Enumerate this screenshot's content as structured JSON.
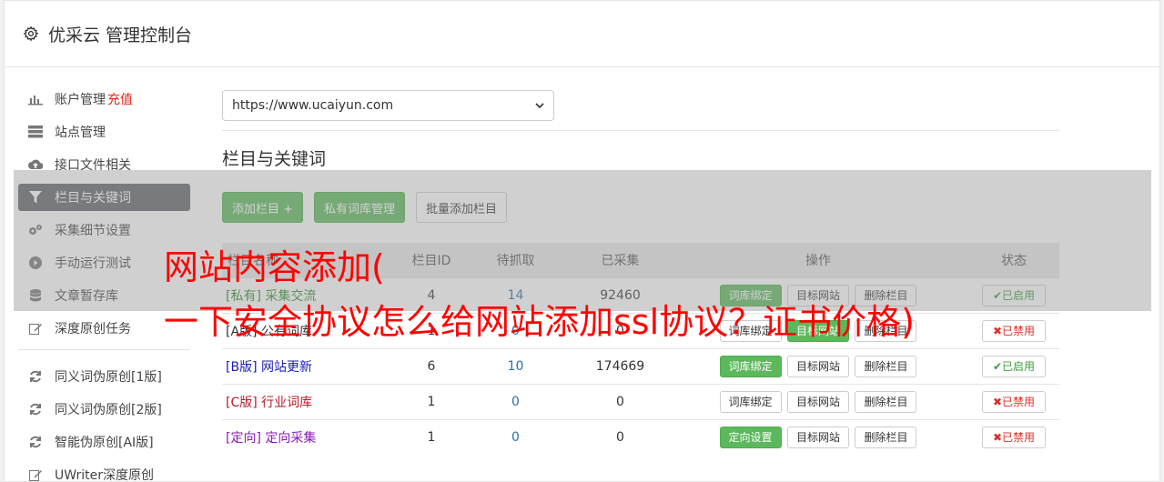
{
  "header": {
    "title": "优采云 管理控制台",
    "icon": "gear-icon"
  },
  "sidebar": {
    "items": [
      {
        "label": "账户管理",
        "extra": "充值",
        "icon": "bar-chart-icon"
      },
      {
        "label": "站点管理",
        "icon": "server-icon"
      },
      {
        "label": "接口文件相关",
        "icon": "cloud-upload-icon"
      },
      {
        "label": "栏目与关键词",
        "icon": "filter-icon",
        "active": true
      },
      {
        "label": "采集细节设置",
        "icon": "cogs-icon"
      },
      {
        "label": "手动运行测试",
        "icon": "play-circle-icon"
      },
      {
        "label": "文章暂存库",
        "icon": "database-icon"
      },
      {
        "label": "深度原创任务",
        "icon": "edit-icon"
      },
      {
        "label": "同义词伪原创[1版]",
        "icon": "refresh-icon"
      },
      {
        "label": "同义词伪原创[2版]",
        "icon": "refresh-icon"
      },
      {
        "label": "智能伪原创[AI版]",
        "icon": "refresh-icon"
      },
      {
        "label": "UWriter深度原创",
        "icon": "edit-icon"
      }
    ]
  },
  "main": {
    "site_select": "https://www.ucaiyun.com",
    "section_title": "栏目与关键词",
    "buttons": {
      "add_column": "添加栏目 +",
      "private_lib": "私有词库管理",
      "batch_add": "批量添加栏目"
    },
    "table": {
      "headers": {
        "name": "栏目名称",
        "id": "栏目ID",
        "pending": "待抓取",
        "collected": "已采集",
        "ops": "操作",
        "status": "状态"
      },
      "rows": [
        {
          "tag": "[私有]",
          "name": "采集交流",
          "id": "4",
          "pending": "14",
          "collected": "92460",
          "op1": "词库绑定",
          "op1_style": "green",
          "op2": "目标网站",
          "op3": "删除栏目",
          "status": "✔已启用",
          "status_on": true
        },
        {
          "tag": "[A版]",
          "name": "公有词库",
          "id": "1",
          "pending": "0",
          "collected": "0",
          "op1": "词库绑定",
          "op1_style": "white",
          "op2": "目标网站",
          "op3": "删除栏目",
          "status": "✖已禁用",
          "status_on": false
        },
        {
          "tag": "[B版]",
          "name": "网站更新",
          "id": "6",
          "pending": "10",
          "collected": "174669",
          "op1": "词库绑定",
          "op1_style": "green",
          "op2": "目标网站",
          "op3": "删除栏目",
          "status": "✔已启用",
          "status_on": true
        },
        {
          "tag": "[C版]",
          "name": "行业词库",
          "id": "1",
          "pending": "0",
          "collected": "0",
          "op1": "词库绑定",
          "op1_style": "white",
          "op2": "目标网站",
          "op3": "删除栏目",
          "status": "✖已禁用",
          "status_on": false
        },
        {
          "tag": "[定向]",
          "name": "定向采集",
          "id": "1",
          "pending": "0",
          "collected": "0",
          "op1": "定向设置",
          "op1_style": "green",
          "op2": "目标网站",
          "op3": "删除栏目",
          "status": "✖已禁用",
          "status_on": false
        }
      ]
    }
  },
  "watermark": {
    "line1": "网站内容添加(",
    "line2": "一下安全协议怎么给网站添加ssl协议？证书价格)"
  },
  "colors": {
    "accent_green": "#5cb85c",
    "active_nav": "#5f6368",
    "watermark": "#ff0000"
  }
}
